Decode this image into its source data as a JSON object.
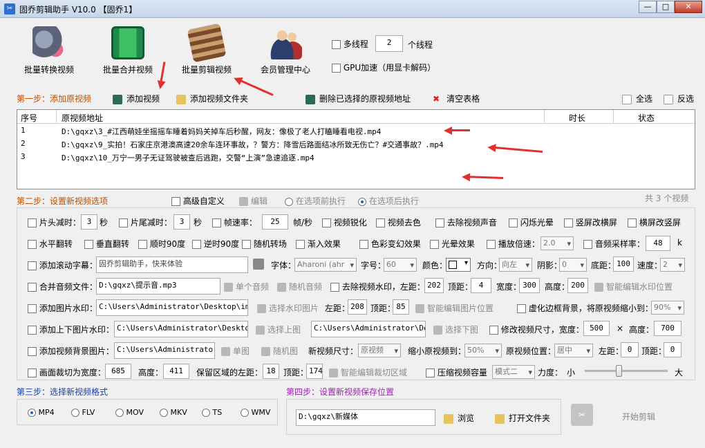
{
  "window": {
    "title": "固乔剪辑助手 V10.0 【固乔1】",
    "min": "—",
    "max": "□",
    "close": "✕"
  },
  "toolbar": {
    "batch_convert": "批量转换视频",
    "batch_merge": "批量合并视频",
    "batch_edit": "批量剪辑视频",
    "member": "会员管理中心",
    "multithread": "多线程",
    "thread_count": "2",
    "thread_unit": "个线程",
    "gpu": "GPU加速（用显卡解码）"
  },
  "step1": {
    "title": "第一步：添加原视频",
    "add_video": "添加视频",
    "add_folder": "添加视频文件夹",
    "delete_selected": "删除已选择的原视频地址",
    "clear_table": "清空表格",
    "select_all": "全选",
    "invert": "反选"
  },
  "table": {
    "columns": [
      "序号",
      "原视频地址",
      "时长",
      "状态"
    ],
    "rows": [
      {
        "no": "1",
        "path": "D:\\gqxz\\3_#江西萌娃坐摇摇车睡着妈妈关掉车后秒醒，网友：像极了老人打瞌睡看电视.mp4",
        "duration": "",
        "status": ""
      },
      {
        "no": "2",
        "path": "D:\\gqxz\\9_实拍！石家庄京港澳高速20余车连环事故，？警方：降雪后路面结冰所致无伤亡？#交通事故？.mp4",
        "duration": "",
        "status": ""
      },
      {
        "no": "3",
        "path": "D:\\gqxz\\10_万宁一男子无证驾驶被查后逃跑，交警“上演”急速追逐.mp4",
        "duration": "",
        "status": ""
      }
    ],
    "count": "共 3 个视频"
  },
  "step2": {
    "title": "第二步：设置新视频选项",
    "advanced": "高级自定义",
    "edit": "编辑",
    "before": "在选项前执行",
    "after": "在选项后执行"
  },
  "row1": {
    "head_cut": "片头减时：",
    "head_val": "3",
    "sec1": "秒",
    "tail_cut": "片尾减时：",
    "tail_val": "3",
    "sec2": "秒",
    "fps": "帧速率：",
    "fps_val": "25",
    "fps_unit": "帧/秒",
    "sharpen": "视频锐化",
    "decolor": "视频去色",
    "mute": "去除视频声音",
    "flash": "闪烁光晕",
    "v2h": "竖屏改横屏",
    "h2v": "横屏改竖屏"
  },
  "row2": {
    "hflip": "水平翻转",
    "vflip": "垂直翻转",
    "cw90": "顺时90度",
    "ccw90": "逆时90度",
    "random_trans": "随机转场",
    "fadein": "渐入效果",
    "color_change": "色彩变幻效果",
    "halo": "光晕效果",
    "speed": "播放倍速：",
    "speed_val": "2.0",
    "samplerate": "音频采样率：",
    "samplerate_val": "48",
    "samplerate_unit": "k"
  },
  "row3": {
    "scroll_caption": "添加滚动字幕：",
    "caption_text": "固乔剪辑助手，快来体验",
    "font": "字体：",
    "font_val": "Aharoni (ahr",
    "size": "字号：",
    "size_val": "60",
    "color": "颜色：",
    "direction": "方向：",
    "direction_val": "向左",
    "shadow": "阴影：",
    "shadow_val": "0",
    "bottom": "底距：",
    "bottom_val": "100",
    "speed": "速度：",
    "speed_val": "2"
  },
  "row4": {
    "merge_audio": "合并音频文件：",
    "audio_path": "D:\\gqxz\\提示音.mp3",
    "single_audio": "单个音频",
    "random_audio": "随机音频",
    "remove_wm": "去除视频水印，左距：",
    "left_val": "202",
    "top": "顶距：",
    "top_val": "4",
    "width": "宽度：",
    "width_val": "300",
    "height": "高度：",
    "height_val": "200",
    "smart_wm": "智能编辑水印位置"
  },
  "row5": {
    "img_wm": "添加图片水印：",
    "img_path": "C:\\Users\\Administrator\\Desktop\\img-q",
    "choose_img": "选择水印图片",
    "left": "左距：",
    "left_val": "208",
    "top": "顶距：",
    "top_val": "85",
    "smart_img": "智能编辑图片位置",
    "blur_bg": "虚化边框背景，将原视频缩小到：",
    "blur_val": "90%"
  },
  "row6": {
    "updown_wm": "添加上下图片水印：",
    "up_path": "C:\\Users\\Administrator\\Desktop\\i",
    "choose_up": "选择上图",
    "down_path": "C:\\Users\\Administrator\\Desk",
    "choose_down": "选择下图",
    "resize": "修改视频尺寸，宽度：",
    "w_val": "500",
    "x": "×",
    "h_label": "高度：",
    "h_val": "700"
  },
  "row7": {
    "bg_img": "添加视频背景图片：",
    "bg_path": "C:\\Users\\Administrator\\D",
    "single_img": "单图",
    "random_img": "随机图",
    "new_size": "新视频尺寸：",
    "new_size_val": "原视频",
    "shrink": "缩小原视频到：",
    "shrink_val": "50%",
    "position": "原视频位置：",
    "position_val": "居中",
    "left": "左距：",
    "left_val": "0",
    "top": "顶距：",
    "top_val": "0"
  },
  "row8": {
    "crop": "画面裁切为宽度：",
    "crop_w": "685",
    "crop_h_label": "高度：",
    "crop_h": "411",
    "keep_left": "保留区域的左距：",
    "keep_left_val": "18",
    "keep_top": "顶距：",
    "keep_top_val": "174",
    "smart_crop": "智能编辑裁切区域",
    "compress": "压缩视频容量",
    "mode_val": "模式二",
    "force": "力度：",
    "small": "小",
    "large": "大",
    "compress_level": 0.4
  },
  "step3": {
    "title": "第三步：选择新视频格式",
    "formats": [
      "MP4",
      "FLV",
      "MOV",
      "MKV",
      "TS",
      "WMV"
    ]
  },
  "step4": {
    "title": "第四步：设置新视频保存位置",
    "path": "D:\\gqxz\\新媒体",
    "browse": "浏览",
    "open_folder": "打开文件夹",
    "start": "开始剪辑"
  }
}
